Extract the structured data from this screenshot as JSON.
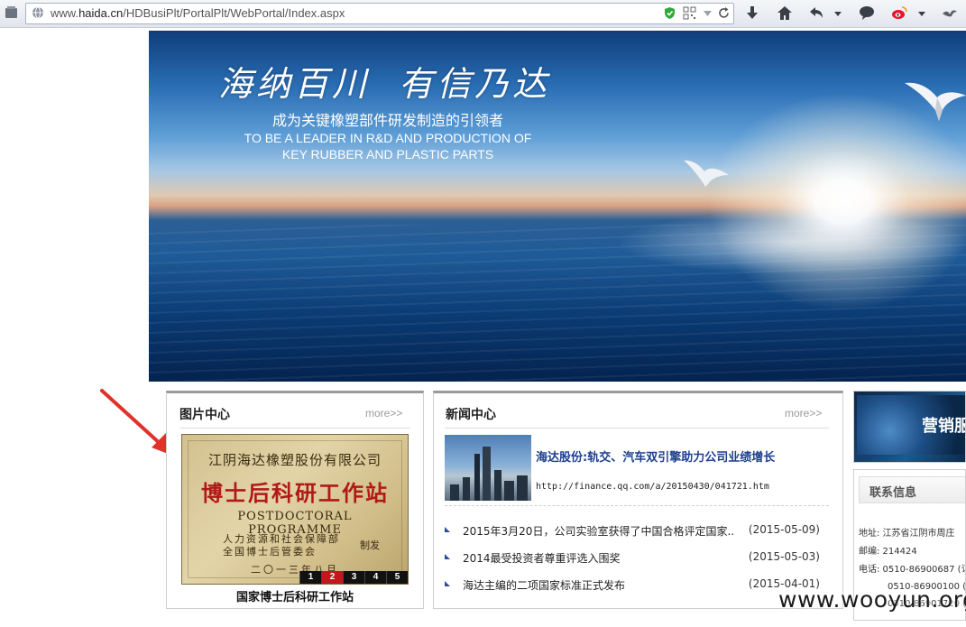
{
  "browser": {
    "url_prefix": "www.",
    "url_domain": "haida.cn",
    "url_path": "/HDBusiPlt/PortalPlt/WebPortal/Index.aspx",
    "icons": [
      "app-menu-icon",
      "globe-icon",
      "shield-icon",
      "qr-code-icon",
      "dropdown-icon",
      "refresh-icon",
      "download-icon",
      "home-icon",
      "back-icon",
      "dropdown-icon",
      "chat-icon",
      "weibo-icon",
      "dropdown-icon",
      "bird-icon"
    ]
  },
  "banner": {
    "calligraphy": "海纳百川  有信乃达",
    "slogan_cn": "成为关键橡塑部件研发制造的引领者",
    "slogan_en_line1": "TO BE A LEADER IN R&D AND PRODUCTION OF",
    "slogan_en_line2": "KEY RUBBER AND PLASTIC PARTS"
  },
  "picture_center": {
    "title": "图片中心",
    "more": "more>>",
    "plaque": {
      "line1": "江阴海达橡塑股份有限公司",
      "line2": "博士后科研工作站",
      "line3": "POSTDOCTORAL PROGRAMME",
      "line4": "人力资源和社会保障部",
      "line5": "全国博士后管委会",
      "line6": "制发",
      "line7": "二〇一三年八月"
    },
    "pages": [
      "1",
      "2",
      "3",
      "4",
      "5"
    ],
    "active_page": "2",
    "caption": "国家博士后科研工作站"
  },
  "news_center": {
    "title": "新闻中心",
    "more": "more>>",
    "headline": "海达股份:轨交、汽车双引擎助力公司业绩增长",
    "headline_url": "http://finance.qq.com/a/20150430/041721.htm",
    "items": [
      {
        "text": "2015年3月20日，公司实验室获得了中国合格评定国家..",
        "date": "(2015-05-09)"
      },
      {
        "text": "2014最受投资者尊重评选入围奖",
        "date": "(2015-05-03)"
      },
      {
        "text": "海达主编的二项国家标准正式发布",
        "date": "(2015-04-01)"
      }
    ]
  },
  "marketing": {
    "label": "营销服"
  },
  "contact": {
    "title": "联系信息",
    "address": "地址: 江苏省江阴市周庄",
    "postcode": "邮编: 214424",
    "phone1": "电话: 0510-86900687 (订",
    "phone2": "0510-86900100 (预",
    "phone3": "0510-86901720 (预"
  },
  "watermark": "www.wooyun.org",
  "colors": {
    "headline": "#1d3f8c",
    "pager_active": "#c4161c",
    "arrow": "#e0312b"
  }
}
